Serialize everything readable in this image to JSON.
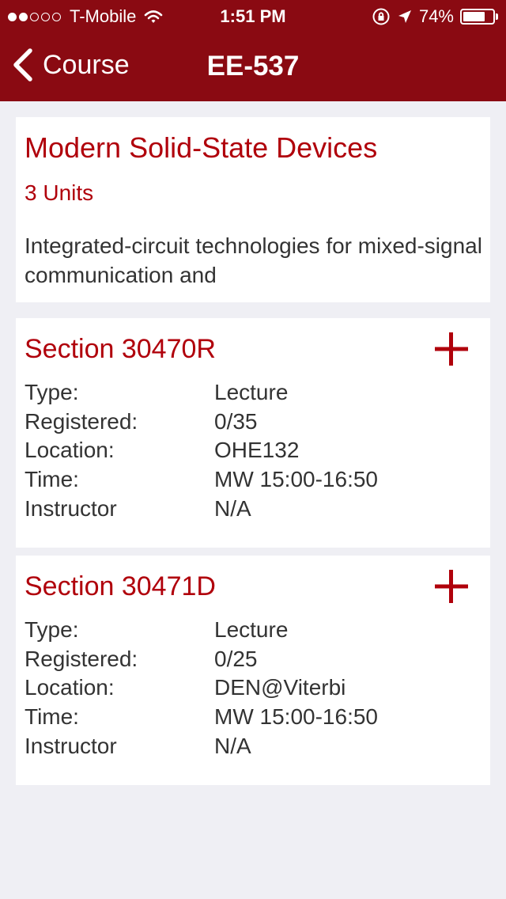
{
  "status_bar": {
    "carrier": "T-Mobile",
    "time": "1:51 PM",
    "battery_percent": "74%",
    "battery_level": 0.74,
    "signal_bars_filled": 2,
    "signal_bars_total": 5,
    "icons": [
      "wifi-icon",
      "rotation-lock-icon",
      "location-arrow-icon",
      "battery-icon"
    ]
  },
  "nav": {
    "back_label": "Course",
    "title": "EE-537",
    "back_icon": "chevron-left-icon"
  },
  "course": {
    "title": "Modern Solid-State Devices",
    "units": "3 Units",
    "description": "Integrated-circuit technologies for mixed-signal communication and"
  },
  "sections": [
    {
      "title": "Section 30470R",
      "rows": [
        {
          "label": "Type:",
          "value": "Lecture"
        },
        {
          "label": "Registered:",
          "value": "0/35"
        },
        {
          "label": "Location:",
          "value": "OHE132"
        },
        {
          "label": "Time:",
          "value": "MW 15:00-16:50"
        },
        {
          "label": "Instructor",
          "value": "N/A"
        }
      ]
    },
    {
      "title": "Section 30471D",
      "rows": [
        {
          "label": "Type:",
          "value": "Lecture"
        },
        {
          "label": "Registered:",
          "value": "0/25"
        },
        {
          "label": "Location:",
          "value": "DEN@Viterbi"
        },
        {
          "label": "Time:",
          "value": "MW 15:00-16:50"
        },
        {
          "label": "Instructor",
          "value": "N/A"
        }
      ]
    }
  ],
  "colors": {
    "nav_background": "#8a0a12",
    "accent_red": "#b0000b",
    "page_background": "#efeff4",
    "card_background": "#ffffff",
    "body_text": "#333333"
  }
}
